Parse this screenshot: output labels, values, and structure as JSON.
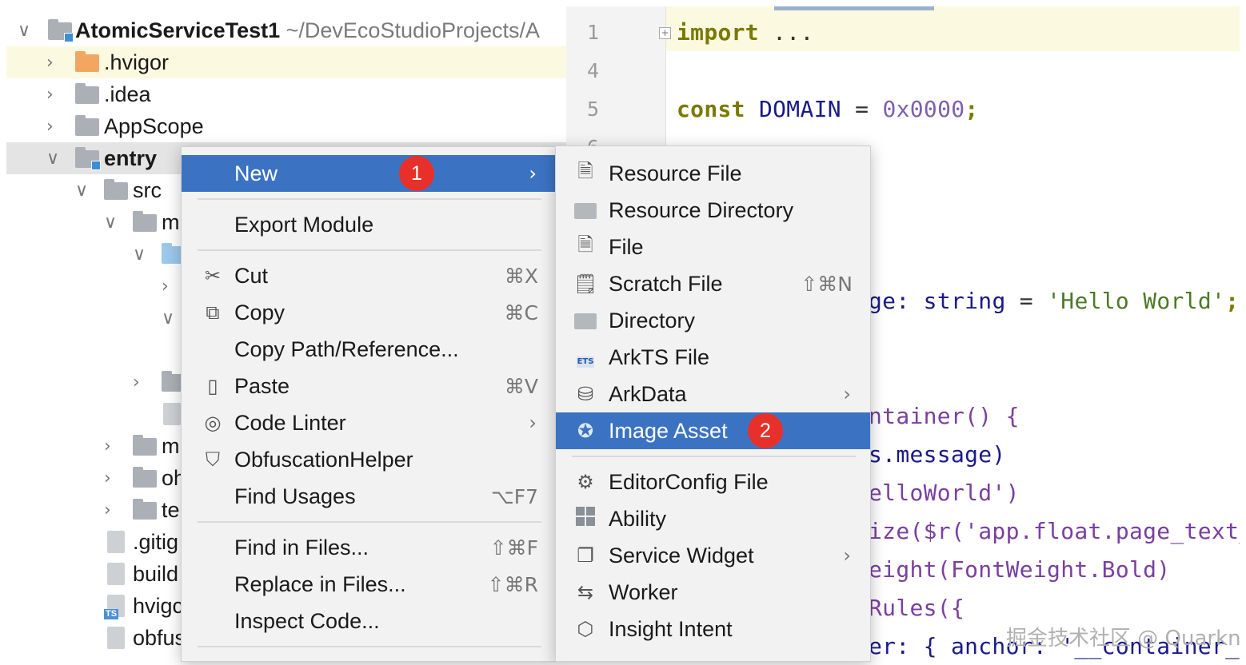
{
  "tree": {
    "rows": [
      {
        "chev": "∨",
        "name": "AtomicServiceTest1",
        "path": "~/DevEcoStudioProjects/A"
      },
      {
        "chev": "›",
        "name": ".hvigor"
      },
      {
        "chev": "›",
        "name": ".idea"
      },
      {
        "chev": "›",
        "name": "AppScope"
      },
      {
        "chev": "∨",
        "name": "entry"
      },
      {
        "chev": "∨",
        "name": "src"
      },
      {
        "chev": "∨",
        "name": "m"
      },
      {
        "chev": "∨",
        "name": ""
      },
      {
        "chev": "›",
        "name": ""
      },
      {
        "chev": "∨",
        "name": ""
      },
      {
        "chev": "›",
        "name": ""
      },
      {
        "chev": "",
        "name": ""
      },
      {
        "chev": "›",
        "name": "m"
      },
      {
        "chev": "›",
        "name": "oh"
      },
      {
        "chev": "›",
        "name": "te"
      },
      {
        "chev": "",
        "name": ".gitig"
      },
      {
        "chev": "",
        "name": "build"
      },
      {
        "chev": "",
        "name": "hvigc"
      },
      {
        "chev": "",
        "name": "obfus"
      }
    ]
  },
  "editor": {
    "line_numbers": [
      "1",
      "4",
      "5",
      "6"
    ],
    "fold_marker": "+",
    "lines": {
      "import_kw": "import",
      "import_dots": "...",
      "const_kw": "const",
      "const_name": "DOMAIN",
      "const_eq": "=",
      "const_val": "0x0000",
      "const_semi": ";",
      "l_msg_a": "ge:",
      "l_msg_b": "string",
      "l_msg_c": "=",
      "l_msg_d": "'Hello World'",
      "l_msg_e": ";",
      "l_container": "ntainer() {",
      "l_message": "s.message)",
      "l_hello": "elloWorld')",
      "l_size": "ize($r('app.float.page_text_",
      "l_weight": "eight(FontWeight.Bold)",
      "l_rules": "Rules({",
      "l_anchor": "er: { anchor: '__container__"
    },
    "watermark": "掘金技术社区 @ Quarkn"
  },
  "context_menu": {
    "items": [
      {
        "label": "New",
        "icon": "",
        "shortcut": "",
        "submenu": true,
        "badge": "1"
      },
      {
        "label": "Export Module",
        "icon": "",
        "shortcut": ""
      },
      {
        "label": "Cut",
        "icon": "scissors-icon",
        "shortcut": "⌘X"
      },
      {
        "label": "Copy",
        "icon": "copy-icon",
        "shortcut": "⌘C"
      },
      {
        "label": "Copy Path/Reference...",
        "icon": "",
        "shortcut": ""
      },
      {
        "label": "Paste",
        "icon": "clipboard-icon",
        "shortcut": "⌘V"
      },
      {
        "label": "Code Linter",
        "icon": "linter-icon",
        "shortcut": "",
        "submenu": true
      },
      {
        "label": "ObfuscationHelper",
        "icon": "shield-icon",
        "shortcut": ""
      },
      {
        "label": "Find Usages",
        "icon": "",
        "shortcut": "⌥F7"
      },
      {
        "label": "Find in Files...",
        "icon": "",
        "shortcut": "⇧⌘F"
      },
      {
        "label": "Replace in Files...",
        "icon": "",
        "shortcut": "⇧⌘R"
      },
      {
        "label": "Inspect Code...",
        "icon": "",
        "shortcut": ""
      }
    ]
  },
  "new_submenu": {
    "items": [
      {
        "label": "Resource File",
        "icon": "resource-file-icon",
        "shortcut": ""
      },
      {
        "label": "Resource Directory",
        "icon": "folder-icon",
        "shortcut": ""
      },
      {
        "label": "File",
        "icon": "file-icon",
        "shortcut": ""
      },
      {
        "label": "Scratch File",
        "icon": "scratch-file-icon",
        "shortcut": "⇧⌘N"
      },
      {
        "label": "Directory",
        "icon": "folder-icon",
        "shortcut": ""
      },
      {
        "label": "ArkTS File",
        "icon": "arkts-file-icon",
        "shortcut": "",
        "icon_text": "ETS"
      },
      {
        "label": "ArkData",
        "icon": "database-icon",
        "shortcut": "",
        "submenu": true
      },
      {
        "label": "Image Asset",
        "icon": "image-asset-icon",
        "shortcut": "",
        "badge": "2"
      },
      {
        "label": "EditorConfig File",
        "icon": "gear-icon",
        "shortcut": ""
      },
      {
        "label": "Ability",
        "icon": "ability-grid-icon",
        "shortcut": ""
      },
      {
        "label": "Service Widget",
        "icon": "widget-icon",
        "shortcut": "",
        "submenu": true
      },
      {
        "label": "Worker",
        "icon": "worker-icon",
        "shortcut": ""
      },
      {
        "label": "Insight Intent",
        "icon": "insight-intent-icon",
        "shortcut": ""
      }
    ]
  },
  "colors": {
    "selection": "#3b73c2",
    "badge": "#e8302a",
    "keyword": "#7a7a00",
    "string": "#4d7a25"
  }
}
